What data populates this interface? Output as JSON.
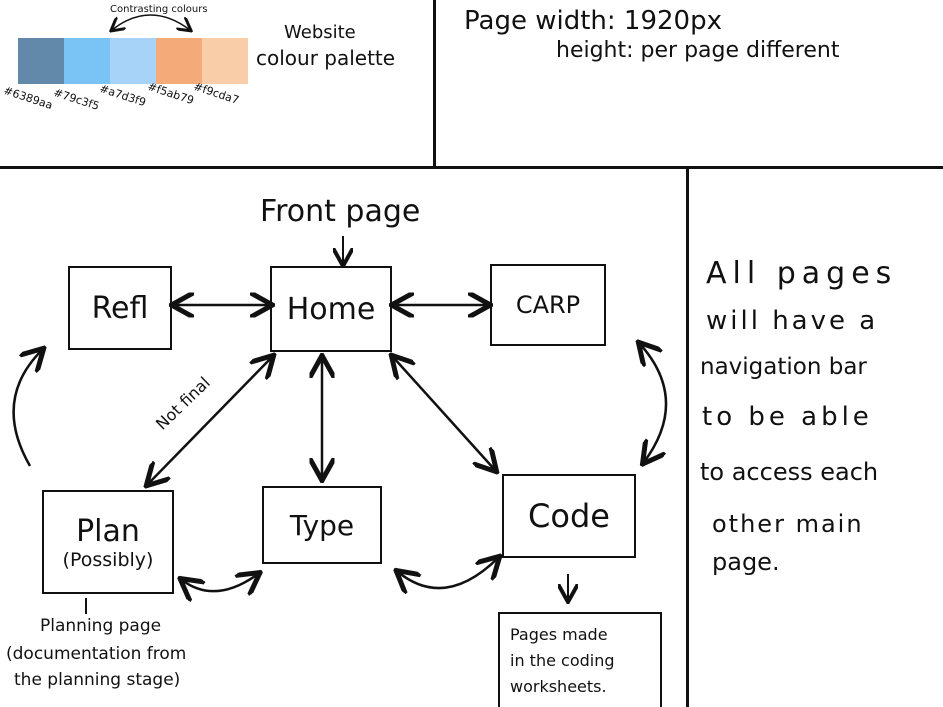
{
  "palette": {
    "contrasting_label": "Contrasting colours",
    "title_line1": "Website",
    "title_line2": "colour palette",
    "swatches": [
      {
        "hex": "#6389aa",
        "label": "#6389aa"
      },
      {
        "hex": "#79c3f5",
        "label": "#79c3f5"
      },
      {
        "hex": "#a7d3f9",
        "label": "#a7d3f9"
      },
      {
        "hex": "#f5ab79",
        "label": "#f5ab79"
      },
      {
        "hex": "#f9cda7",
        "label": "#f9cda7"
      }
    ]
  },
  "page_info": {
    "width_line": "Page width: 1920px",
    "height_line": "height: per page different"
  },
  "sitemap": {
    "front_page_label": "Front page",
    "home": "Home",
    "refl": "Refl",
    "carp": "CARP",
    "plan": "Plan",
    "plan_note": "(Possibly)",
    "type": "Type",
    "code": "Code",
    "not_final": "Not final",
    "planning_note_line1": "Planning page",
    "planning_note_line2": "(documentation from",
    "planning_note_line3": "the planning stage)",
    "pages_note_line1": "Pages made",
    "pages_note_line2": "in the coding",
    "pages_note_line3": "worksheets."
  },
  "sidebar_note": {
    "line1": "All pages",
    "line2": "will have a",
    "line3": "navigation bar",
    "line4": "to be able",
    "line5": "to access each",
    "line6": "other main",
    "line7": "page."
  }
}
